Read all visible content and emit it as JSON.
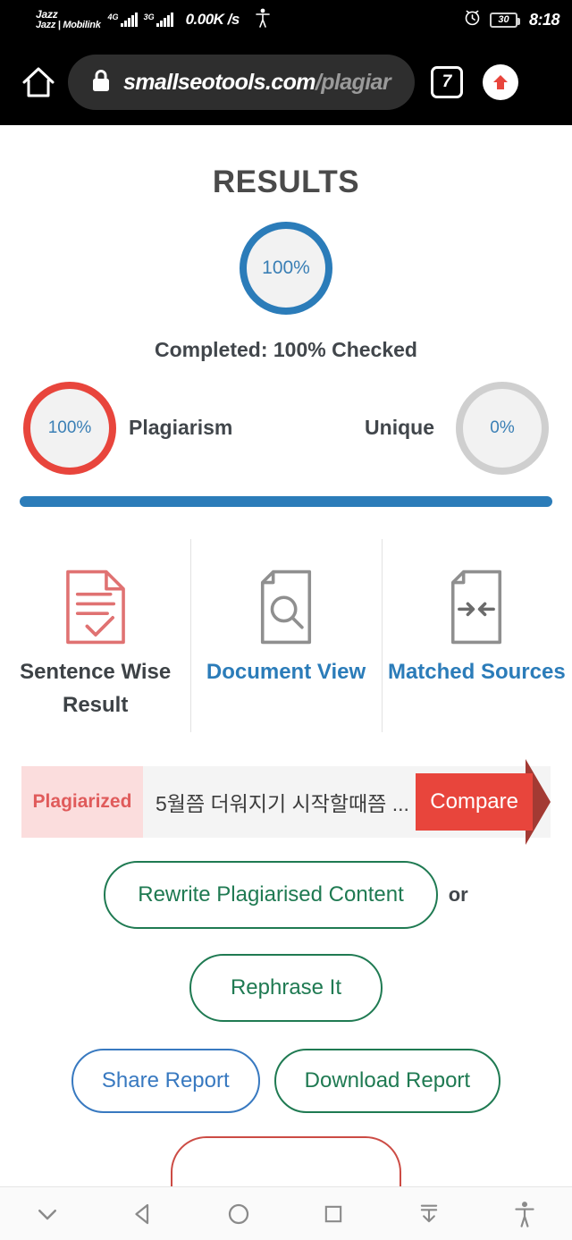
{
  "status_bar": {
    "carrier_line1": "Jazz",
    "carrier_line2": "Jazz | Mobilink",
    "sim1_network": "4G",
    "sim2_network": "3G",
    "net_speed": "0.00K /s",
    "battery_level": "30",
    "clock": "8:18",
    "alarm_icon": "alarm-clock-icon",
    "accessibility_icon": "accessibility-icon"
  },
  "browser_bar": {
    "home_icon": "home-icon",
    "lock_icon": "lock-icon",
    "url_host": "smallseotools.com",
    "url_path": "/plagiar",
    "tab_count": "7",
    "upload_icon": "upload-arrow-icon"
  },
  "page": {
    "title": "RESULTS",
    "main_gauge_value": "100%",
    "completed_text": "Completed: 100% Checked",
    "plagiarism": {
      "value": "100%",
      "label": "Plagiarism"
    },
    "unique": {
      "value": "0%",
      "label": "Unique"
    },
    "progress_percent": 100,
    "tabs": [
      {
        "label": "Sentence Wise Result",
        "icon": "document-check-icon",
        "state": "active"
      },
      {
        "label": "Document View",
        "icon": "document-search-icon",
        "state": "link"
      },
      {
        "label": "Matched Sources",
        "icon": "document-match-arrows-icon",
        "state": "link"
      }
    ],
    "sentence_row": {
      "tag": "Plagiarized",
      "text": "5월쯤 더워지기 시작할때쯤 ...",
      "compare_label": "Compare"
    },
    "actions": {
      "rewrite_label": "Rewrite Plagiarised Content",
      "or_label": "or",
      "rephrase_label": "Rephrase It",
      "share_label": "Share Report",
      "download_label": "Download Report"
    }
  },
  "nav_bar": {
    "items": [
      {
        "icon": "chevron-down-icon"
      },
      {
        "icon": "back-triangle-icon"
      },
      {
        "icon": "home-circle-icon"
      },
      {
        "icon": "recents-square-icon"
      },
      {
        "icon": "download-icon"
      },
      {
        "icon": "accessibility-icon"
      }
    ]
  },
  "colors": {
    "accent_blue": "#2b7cb9",
    "plagiarism_red": "#e8453c",
    "unique_grey": "#cfcfcf",
    "green": "#1f7a52",
    "link_blue": "#3879c0"
  }
}
